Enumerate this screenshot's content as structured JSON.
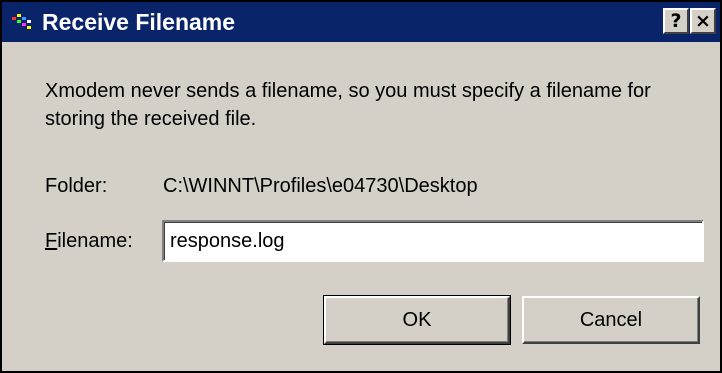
{
  "window": {
    "title": "Receive Filename",
    "app_icon": "terminal-app-icon",
    "help_label": "?",
    "close_label": "×"
  },
  "message": "Xmodem never sends a filename, so you must specify a filename for storing the received file.",
  "folder": {
    "label": "Folder:",
    "path": "C:\\WINNT\\Profiles\\e04730\\Desktop"
  },
  "filename": {
    "label_mnemonic": "F",
    "label_rest": "ilename:",
    "value": "response.log"
  },
  "buttons": {
    "ok": "OK",
    "cancel": "Cancel"
  },
  "colors": {
    "titlebar": "#0a246a",
    "face": "#d4d0c8"
  }
}
